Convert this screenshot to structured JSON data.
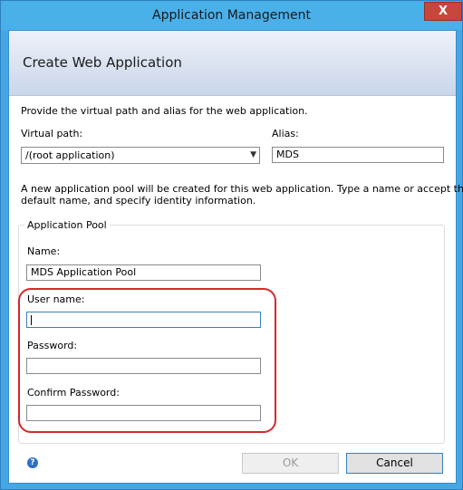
{
  "window": {
    "title": "Application Management",
    "close_label": "X"
  },
  "banner": {
    "title": "Create Web Application"
  },
  "form": {
    "instructions": "Provide the virtual path and alias for the web application.",
    "virtual_path_label": "Virtual path:",
    "virtual_path_value": "/(root application)",
    "alias_label": "Alias:",
    "alias_value": "MDS",
    "pool_note_line1": "A new application pool will be created for this web application. Type a name or accept the",
    "pool_note_line2": "default name, and specify identity information."
  },
  "app_pool": {
    "legend": "Application Pool",
    "name_label": "Name:",
    "name_value": "MDS Application Pool",
    "username_label": "User name:",
    "username_value": "",
    "password_label": "Password:",
    "password_value": "",
    "confirm_password_label": "Confirm Password:",
    "confirm_password_value": ""
  },
  "footer": {
    "help_glyph": "?",
    "ok_label": "OK",
    "cancel_label": "Cancel"
  },
  "colors": {
    "title_bar": "#4ab0ea",
    "close_button": "#c7473a",
    "highlight_outline": "#d42a2a",
    "banner_gradient_end": "#c9d6ea"
  }
}
